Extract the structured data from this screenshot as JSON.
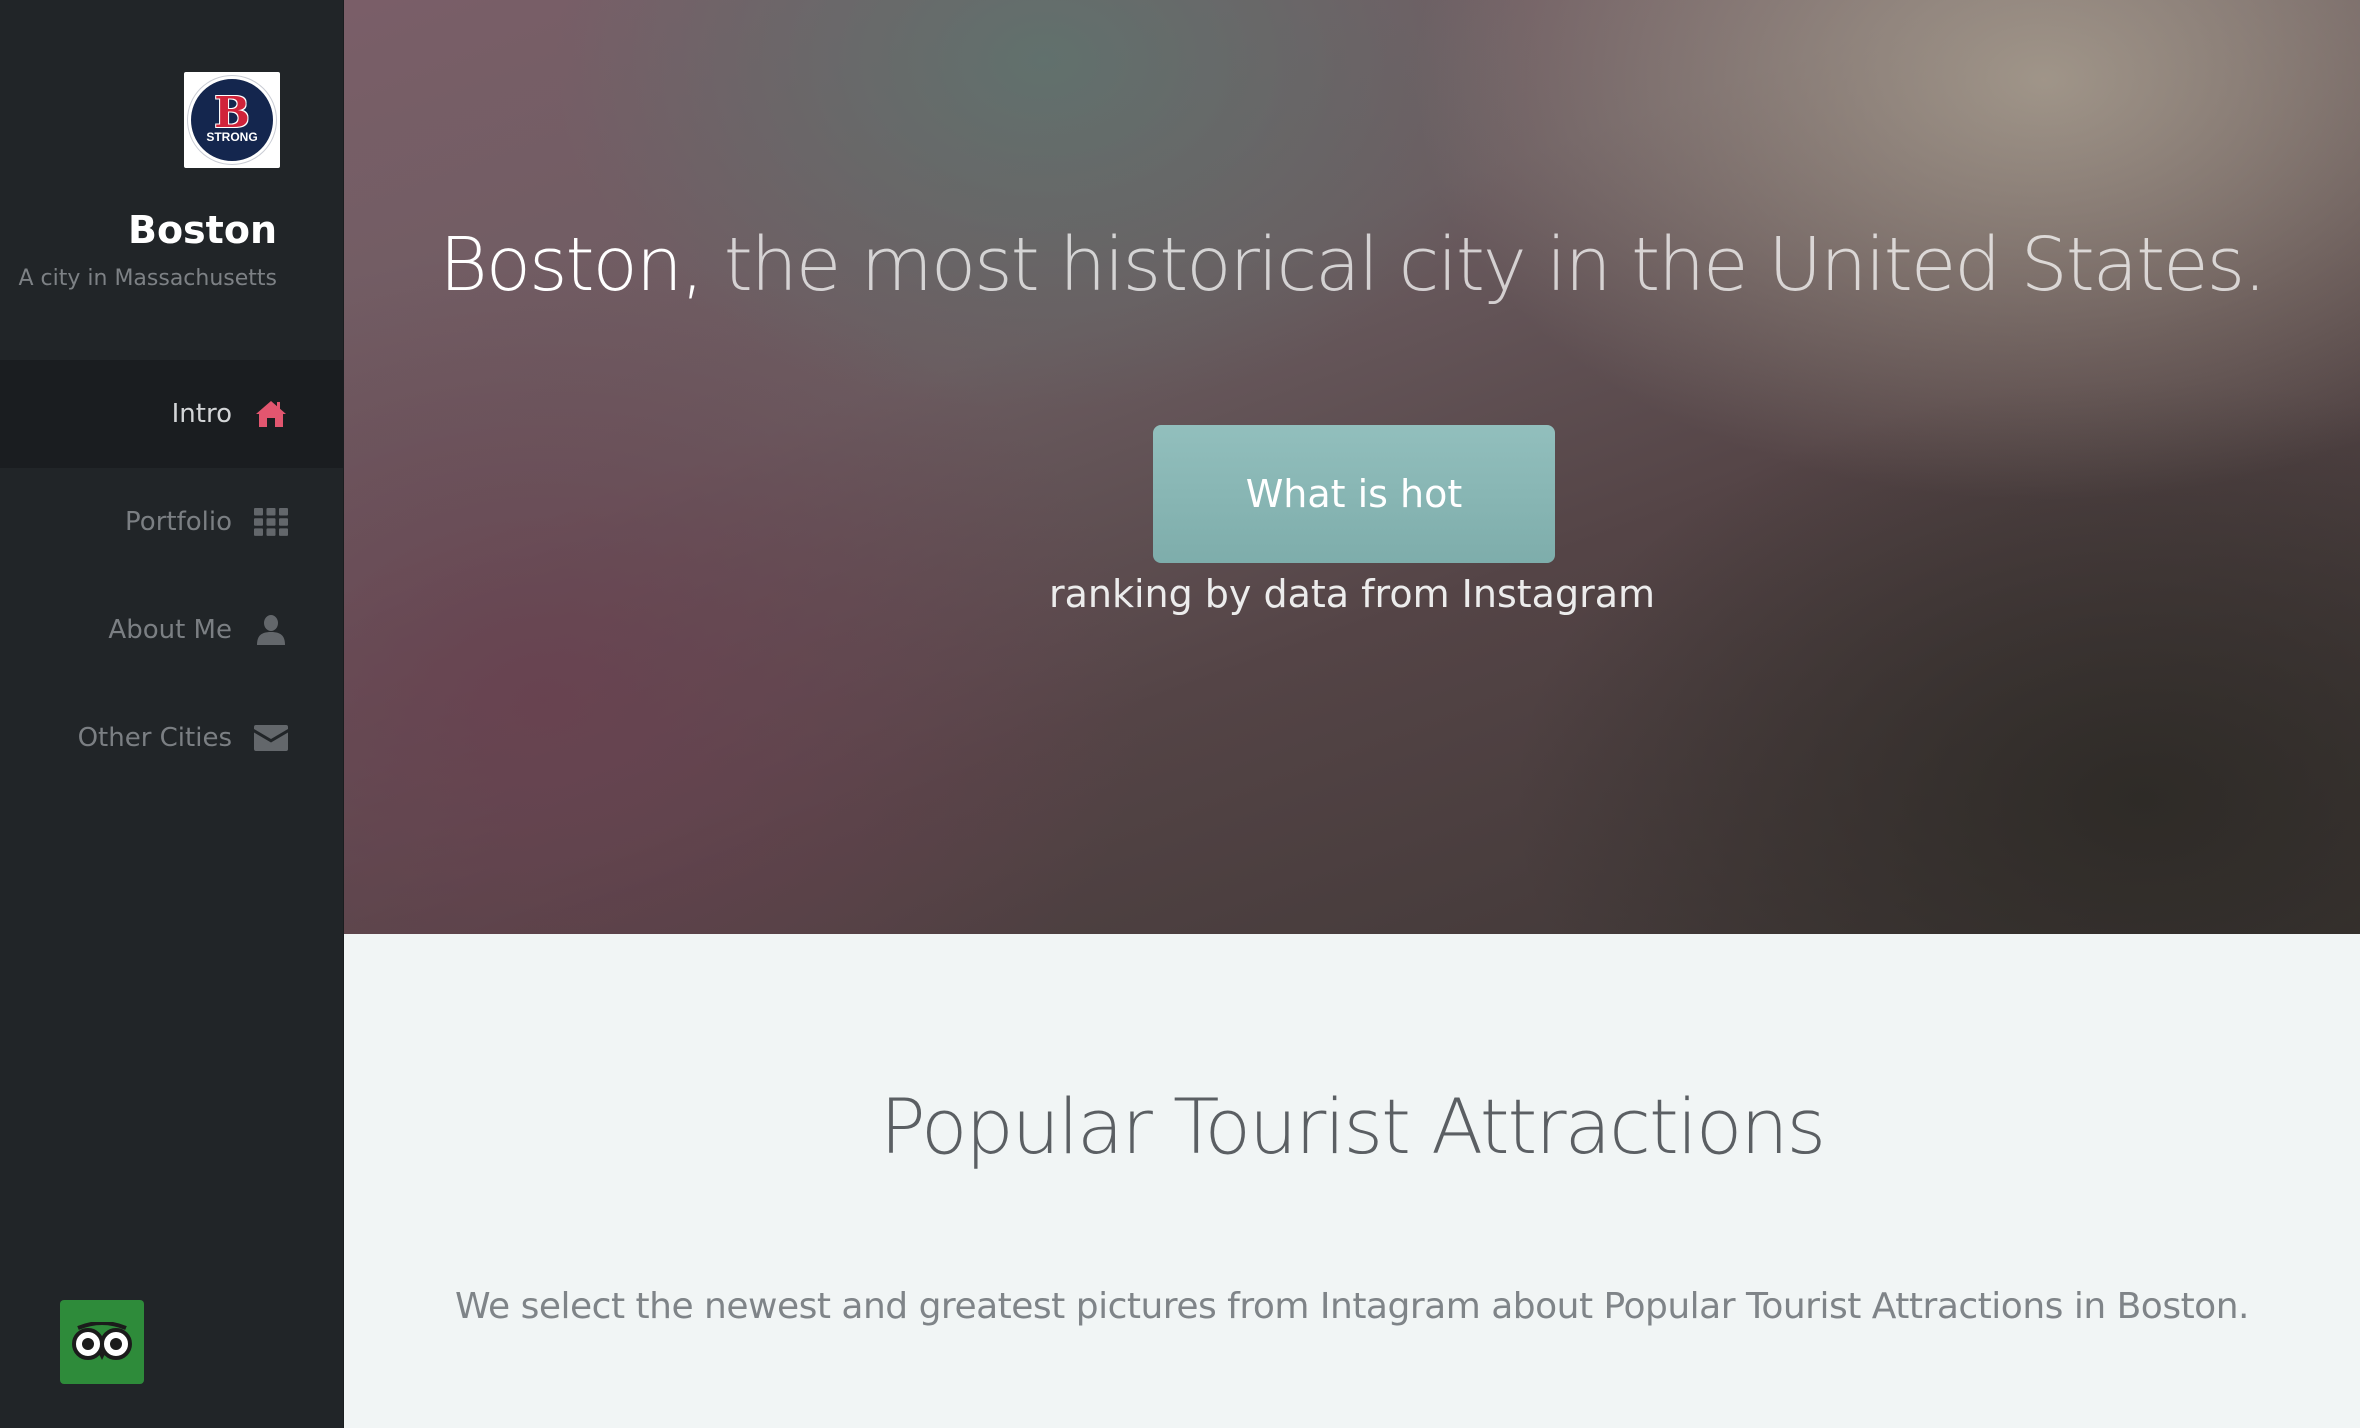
{
  "sidebar": {
    "logo": {
      "letter": "B",
      "word": "STRONG",
      "icon": "b-strong-logo-icon"
    },
    "title": "Boston",
    "subtitle": "A city in Massachusetts",
    "nav": [
      {
        "label": "Intro",
        "icon": "home-icon",
        "active": true
      },
      {
        "label": "Portfolio",
        "icon": "grid-icon",
        "active": false
      },
      {
        "label": "About Me",
        "icon": "user-icon",
        "active": false
      },
      {
        "label": "Other Cities",
        "icon": "envelope-icon",
        "active": false
      }
    ],
    "footer_icon": "tripadvisor-owl-icon"
  },
  "hero": {
    "headline_strong": "Boston,",
    "headline_rest": " the most historical city in the United States.",
    "cta_label": "What is hot",
    "cta_caption": "ranking by data from Instagram"
  },
  "section": {
    "title": "Popular Tourist Attractions",
    "text": "We select the newest and greatest pictures from Intagram about Popular Tourist Attractions in Boston."
  },
  "colors": {
    "sidebar_bg": "#212528",
    "accent_icon": "#e2566f",
    "cta_bg": "#88b7b5",
    "content_bg": "#f1f5f5"
  }
}
